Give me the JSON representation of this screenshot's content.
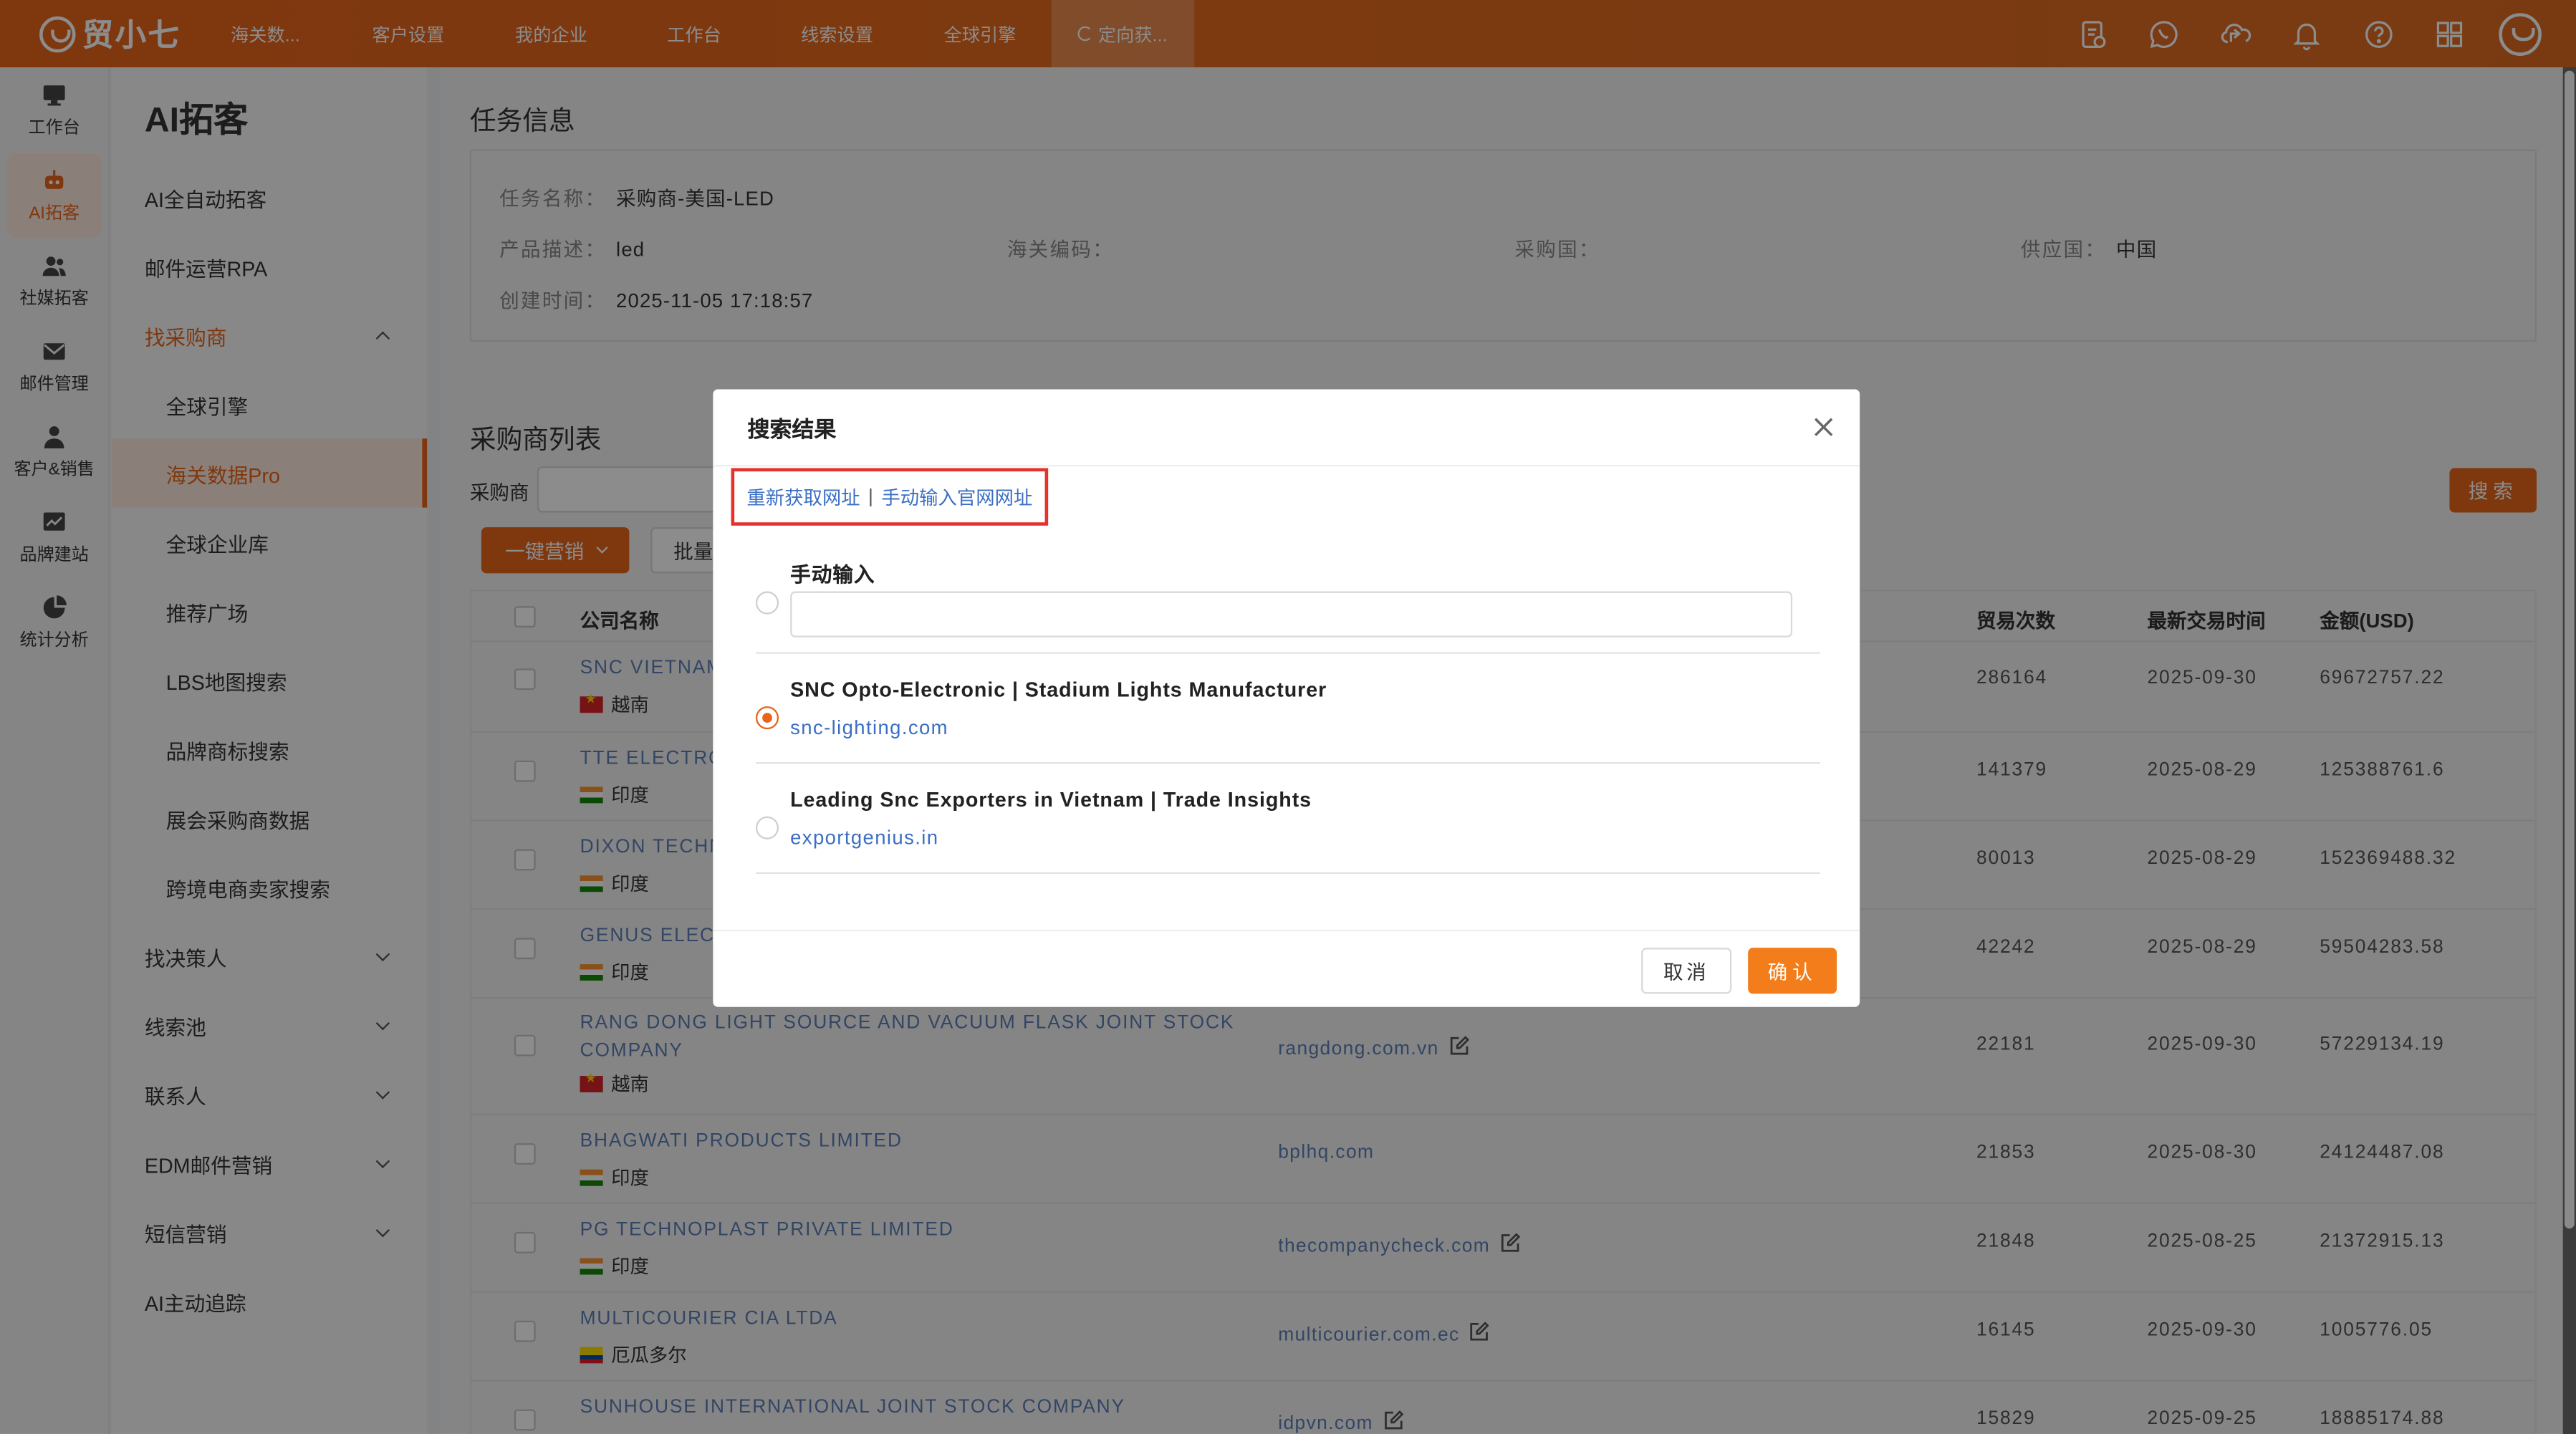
{
  "app": {
    "logo_text": "贸小七"
  },
  "topnav": {
    "items": [
      "海关数...",
      "客户设置",
      "我的企业",
      "工作台",
      "线索设置",
      "全球引擎"
    ],
    "active_tab": "定向获..."
  },
  "top_icons": [
    "document-check-icon",
    "whatsapp-icon",
    "share-cloud-icon",
    "bell-icon",
    "help-icon",
    "grid-apps-icon",
    "user-avatar-icon"
  ],
  "rail": {
    "items": [
      {
        "label": "工作台",
        "icon": "monitor-icon"
      },
      {
        "label": "AI拓客",
        "icon": "robot-icon"
      },
      {
        "label": "社媒拓客",
        "icon": "users-icon"
      },
      {
        "label": "邮件管理",
        "icon": "mail-icon"
      },
      {
        "label": "客户&销售",
        "icon": "person-icon"
      },
      {
        "label": "品牌建站",
        "icon": "chart-screen-icon"
      },
      {
        "label": "统计分析",
        "icon": "pie-icon"
      }
    ]
  },
  "sidebar": {
    "title": "AI拓客",
    "items": [
      {
        "label": "AI全自动拓客"
      },
      {
        "label": "邮件运营RPA"
      },
      {
        "label": "找采购商"
      },
      {
        "label": "全球引擎"
      },
      {
        "label": "海关数据Pro"
      },
      {
        "label": "全球企业库"
      },
      {
        "label": "推荐广场"
      },
      {
        "label": "LBS地图搜索"
      },
      {
        "label": "品牌商标搜索"
      },
      {
        "label": "展会采购商数据"
      },
      {
        "label": "跨境电商卖家搜索"
      },
      {
        "label": "找决策人"
      },
      {
        "label": "线索池"
      },
      {
        "label": "联系人"
      },
      {
        "label": "EDM邮件营销"
      },
      {
        "label": "短信营销"
      },
      {
        "label": "AI主动追踪"
      }
    ]
  },
  "task": {
    "section_title": "任务信息",
    "name_label": "任务名称：",
    "name_value": "采购商-美国-LED",
    "desc_label": "产品描述：",
    "desc_value": "led",
    "hs_label": "海关编码：",
    "buyer_country_label": "采购国：",
    "supplier_label": "供应国：",
    "supplier_value": "中国",
    "created_label": "创建时间：",
    "created_value": "2025-11-05 17:18:57"
  },
  "list": {
    "section_title": "采购商列表",
    "buyer_label": "采购商",
    "search_button": "搜索",
    "market_button": "一键营销",
    "batch_button": "批量",
    "columns": {
      "company": "公司名称",
      "trades": "贸易次数",
      "latest": "最新交易时间",
      "amount": "金额(USD)"
    },
    "rows": [
      {
        "name": "SNC VIETNAM",
        "country": "越南",
        "flag": "vn",
        "site": "",
        "trades": "286164",
        "date": "2025-09-30",
        "amount": "69672757.22"
      },
      {
        "name": "TTE ELECTRO",
        "country": "印度",
        "flag": "in",
        "site": "",
        "trades": "141379",
        "date": "2025-08-29",
        "amount": "125388761.6"
      },
      {
        "name": "DIXON TECHN",
        "country": "印度",
        "flag": "in",
        "site": "",
        "trades": "80013",
        "date": "2025-08-29",
        "amount": "152369488.32"
      },
      {
        "name": "GENUS ELECT",
        "country": "印度",
        "flag": "in",
        "site": "",
        "trades": "42242",
        "date": "2025-08-29",
        "amount": "59504283.58"
      },
      {
        "name": "RANG DONG LIGHT SOURCE AND VACUUM FLASK JOINT STOCK",
        "name2": "COMPANY",
        "country": "越南",
        "flag": "vn",
        "site": "rangdong.com.vn",
        "trades": "22181",
        "date": "2025-09-30",
        "amount": "57229134.19"
      },
      {
        "name": "BHAGWATI PRODUCTS LIMITED",
        "country": "印度",
        "flag": "in",
        "site": "bplhq.com",
        "trades": "21853",
        "date": "2025-08-30",
        "amount": "24124487.08"
      },
      {
        "name": "PG TECHNOPLAST PRIVATE LIMITED",
        "country": "印度",
        "flag": "in",
        "site": "thecompanycheck.com",
        "trades": "21848",
        "date": "2025-08-25",
        "amount": "21372915.13"
      },
      {
        "name": "MULTICOURIER CIA LTDA",
        "country": "厄瓜多尔",
        "flag": "ec",
        "site": "multicourier.com.ec",
        "trades": "16145",
        "date": "2025-09-30",
        "amount": "1005776.05"
      },
      {
        "name": "SUNHOUSE INTERNATIONAL JOINT STOCK COMPANY",
        "country": "",
        "flag": "",
        "site": "idpvn.com",
        "trades": "15829",
        "date": "2025-09-25",
        "amount": "18885174.88"
      }
    ]
  },
  "modal": {
    "title": "搜索结果",
    "refetch_link": "重新获取网址",
    "separator": "|",
    "manual_link": "手动输入官网网址",
    "manual_label": "手动输入",
    "manual_value": "",
    "options": [
      {
        "title": "SNC Opto-Electronic | Stadium Lights Manufacturer",
        "url": "snc-lighting.com",
        "selected": true
      },
      {
        "title": "Leading Snc Exporters in Vietnam | Trade Insights",
        "url": "exportgenius.in",
        "selected": false
      }
    ],
    "cancel": "取消",
    "confirm": "确认"
  },
  "colors": {
    "brand": "#e8641b",
    "link": "#3b6fc4",
    "highlight_box": "#e5322d"
  }
}
